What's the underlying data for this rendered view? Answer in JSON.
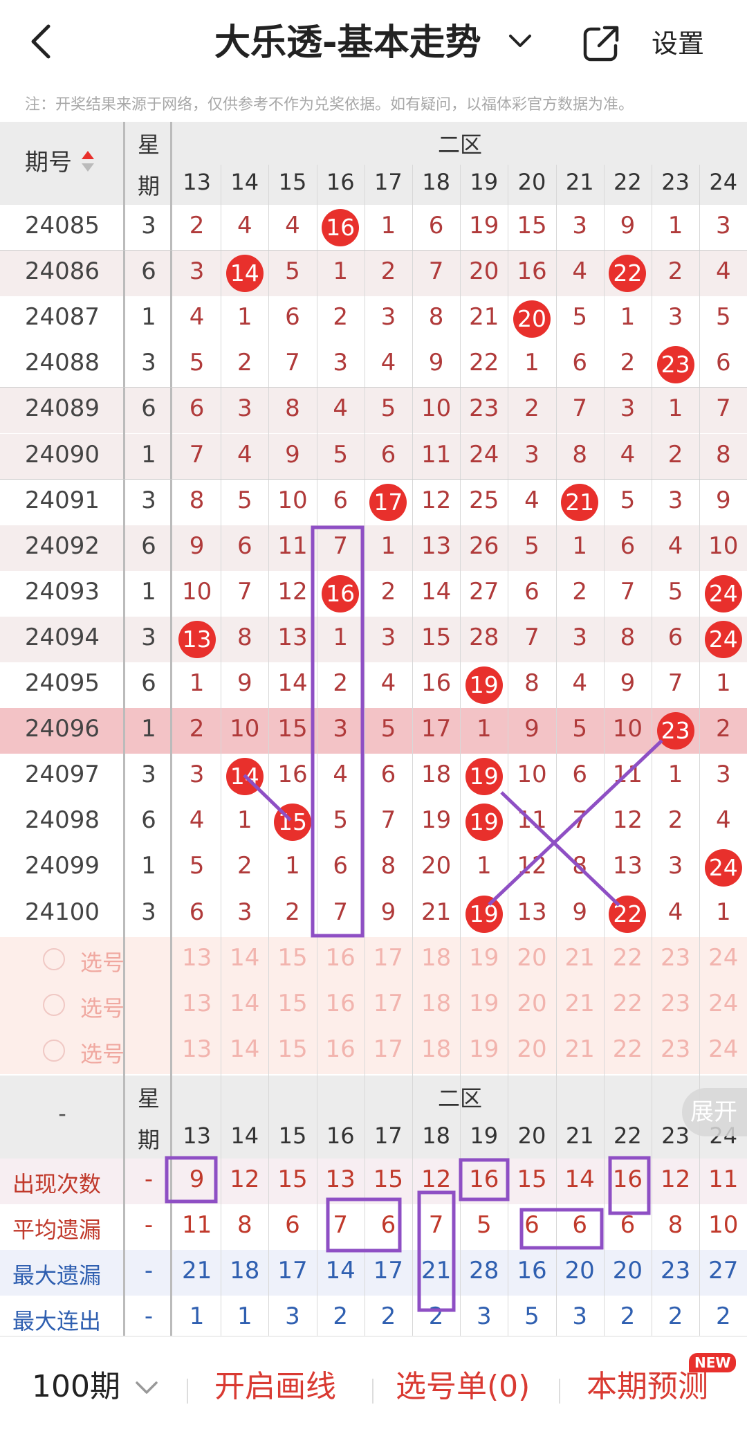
{
  "header": {
    "back_icon": "back-chevron-icon",
    "title": "大乐透-基本走势",
    "dropdown_icon": "chevron-down-icon",
    "share_icon": "external-link-icon",
    "settings_label": "设置"
  },
  "note": "注：开奖结果来源于网络，仅供参考不作为兑奖依据。如有疑问，以福体彩官方数据为准。",
  "table": {
    "col_issue": "期号",
    "col_week": [
      "星",
      "期"
    ],
    "zone_label": "二区",
    "columns": [
      "13",
      "14",
      "15",
      "16",
      "17",
      "18",
      "19",
      "20",
      "21",
      "22",
      "23",
      "24"
    ],
    "rows": [
      {
        "issue": "24085",
        "week": "3",
        "vals": [
          "2",
          "4",
          "4",
          "16",
          "1",
          "6",
          "19",
          "15",
          "3",
          "9",
          "1",
          "3"
        ],
        "hits": [
          3
        ]
      },
      {
        "issue": "24086",
        "week": "6",
        "vals": [
          "3",
          "14",
          "5",
          "1",
          "2",
          "7",
          "20",
          "16",
          "4",
          "22",
          "2",
          "4"
        ],
        "hits": [
          1,
          9
        ]
      },
      {
        "issue": "24087",
        "week": "1",
        "vals": [
          "4",
          "1",
          "6",
          "2",
          "3",
          "8",
          "21",
          "20",
          "5",
          "1",
          "3",
          "5"
        ],
        "hits": [
          7
        ]
      },
      {
        "issue": "24088",
        "week": "3",
        "vals": [
          "5",
          "2",
          "7",
          "3",
          "4",
          "9",
          "22",
          "1",
          "6",
          "2",
          "23",
          "6"
        ],
        "hits": [
          10
        ]
      },
      {
        "issue": "24089",
        "week": "6",
        "vals": [
          "6",
          "3",
          "8",
          "4",
          "5",
          "10",
          "23",
          "2",
          "7",
          "3",
          "1",
          "7"
        ],
        "hits": []
      },
      {
        "issue": "24090",
        "week": "1",
        "vals": [
          "7",
          "4",
          "9",
          "5",
          "6",
          "11",
          "24",
          "3",
          "8",
          "4",
          "2",
          "8"
        ],
        "hits": []
      },
      {
        "issue": "24091",
        "week": "3",
        "vals": [
          "8",
          "5",
          "10",
          "6",
          "17",
          "12",
          "25",
          "4",
          "21",
          "5",
          "3",
          "9"
        ],
        "hits": [
          4,
          8
        ]
      },
      {
        "issue": "24092",
        "week": "6",
        "vals": [
          "9",
          "6",
          "11",
          "7",
          "1",
          "13",
          "26",
          "5",
          "1",
          "6",
          "4",
          "10"
        ],
        "hits": []
      },
      {
        "issue": "24093",
        "week": "1",
        "vals": [
          "10",
          "7",
          "12",
          "16",
          "2",
          "14",
          "27",
          "6",
          "2",
          "7",
          "5",
          "24"
        ],
        "hits": [
          3,
          11
        ]
      },
      {
        "issue": "24094",
        "week": "3",
        "vals": [
          "13",
          "8",
          "13",
          "1",
          "3",
          "15",
          "28",
          "7",
          "3",
          "8",
          "6",
          "24"
        ],
        "hits": [
          0,
          11
        ]
      },
      {
        "issue": "24095",
        "week": "6",
        "vals": [
          "1",
          "9",
          "14",
          "2",
          "4",
          "16",
          "19",
          "8",
          "4",
          "9",
          "7",
          "1"
        ],
        "hits": [
          6
        ]
      },
      {
        "issue": "24096",
        "week": "1",
        "vals": [
          "2",
          "10",
          "15",
          "3",
          "5",
          "17",
          "1",
          "9",
          "5",
          "10",
          "23",
          "2"
        ],
        "hits": [
          10
        ]
      },
      {
        "issue": "24097",
        "week": "3",
        "vals": [
          "3",
          "14",
          "16",
          "4",
          "6",
          "18",
          "19",
          "10",
          "6",
          "11",
          "1",
          "3"
        ],
        "hits": [
          1,
          6
        ]
      },
      {
        "issue": "24098",
        "week": "6",
        "vals": [
          "4",
          "1",
          "15",
          "5",
          "7",
          "19",
          "19",
          "11",
          "7",
          "12",
          "2",
          "4"
        ],
        "hits": [
          2,
          6
        ]
      },
      {
        "issue": "24099",
        "week": "1",
        "vals": [
          "5",
          "2",
          "1",
          "6",
          "8",
          "20",
          "1",
          "12",
          "8",
          "13",
          "3",
          "24"
        ],
        "hits": [
          11
        ]
      },
      {
        "issue": "24100",
        "week": "3",
        "vals": [
          "6",
          "3",
          "2",
          "7",
          "9",
          "21",
          "19",
          "13",
          "9",
          "22",
          "4",
          "1"
        ],
        "hits": [
          6,
          9
        ]
      }
    ],
    "select_label": "选号",
    "select_rows": 3
  },
  "stats": {
    "dash": "-",
    "week_label": [
      "星",
      "期"
    ],
    "zone_label": "二区",
    "expand_label": "展开",
    "rows": [
      {
        "label": "出现次数",
        "color": "#c0392b",
        "vals": [
          "9",
          "12",
          "15",
          "13",
          "15",
          "12",
          "16",
          "15",
          "14",
          "16",
          "12",
          "11"
        ]
      },
      {
        "label": "平均遗漏",
        "color": "#c0392b",
        "vals": [
          "11",
          "8",
          "6",
          "7",
          "6",
          "7",
          "5",
          "6",
          "6",
          "6",
          "8",
          "10"
        ]
      },
      {
        "label": "最大遗漏",
        "color": "#2f5fb0",
        "vals": [
          "21",
          "18",
          "17",
          "14",
          "17",
          "21",
          "28",
          "16",
          "20",
          "20",
          "23",
          "27"
        ]
      },
      {
        "label": "最大连出",
        "color": "#2f5fb0",
        "vals": [
          "1",
          "1",
          "3",
          "2",
          "2",
          "2",
          "3",
          "5",
          "3",
          "2",
          "2",
          "2"
        ]
      }
    ]
  },
  "footer": {
    "periods": "100期",
    "periods_icon": "chevron-down-icon",
    "draw_line": "开启画线",
    "selection_list": "选号单(0)",
    "prediction": "本期预测",
    "new_badge": "NEW"
  },
  "colors": {
    "accent": "#e8302c",
    "value_red": "#b03a3a",
    "annotation_purple": "#8e4fc4",
    "highlight_row": "#f3c3c6"
  }
}
